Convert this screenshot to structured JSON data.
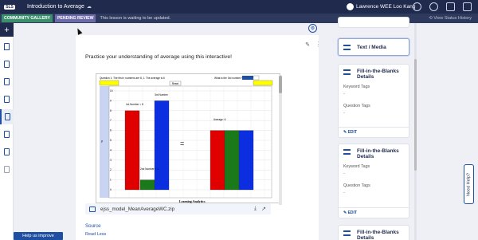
{
  "app": {
    "logo_text": "SLS",
    "lesson_title": "Introduction to Average",
    "user_name": "Lawrence WEE Loo Kang"
  },
  "subbar": {
    "community_badge": "COMMUNITY GALLERY",
    "pending_badge": "PENDING REVIEW",
    "message": "This lesson is waiting to be updated.",
    "history": "View Status History"
  },
  "main": {
    "prompt": "Practice your understanding of average using this interactive!",
    "file_name": "ejss_model_MeanAverageWC.zip",
    "source_label": "Source",
    "read_less": "Read Less",
    "help_button": "Help us improve"
  },
  "sim": {
    "question": "Question 1: The first n numbers are 8, 1. The average is 6",
    "question2": "What is the 3rd number?",
    "reset": "Reset",
    "first_label": "1st Number = 8",
    "second_label": "2nd Number = 1",
    "third_label": "3rd Number",
    "average_label": "Average: 6",
    "footer": "Learning Analytics",
    "equals": "=",
    "y_axis": "y",
    "y_ticks": [
      "10",
      "9",
      "8",
      "7",
      "6",
      "5",
      "4",
      "3",
      "2",
      "1",
      "0"
    ]
  },
  "chart_data": {
    "type": "bar",
    "title": "",
    "categories": [
      "1st Number",
      "2nd Number",
      "3rd Number",
      "Average",
      "Average",
      "Average"
    ],
    "values": [
      8,
      1,
      9,
      6,
      6,
      6
    ],
    "colors": [
      "#e00000",
      "#1a7a1a",
      "#0a2ee0",
      "#e00000",
      "#1a7a1a",
      "#0a2ee0"
    ],
    "ylim": [
      0,
      10
    ],
    "xlabel": "Learning Analytics",
    "ylabel": "y"
  },
  "right_panel": {
    "cards": [
      {
        "title": "Text / Media"
      },
      {
        "title": "Fill-in-the-Blanks Details",
        "label1": "Keyword Tags",
        "value1": "-",
        "label2": "Question Tags",
        "value2": "-",
        "edit": "EDIT"
      },
      {
        "title": "Fill-in-the-Blanks Details",
        "label1": "Keyword Tags",
        "value1": "-",
        "label2": "Question Tags",
        "value2": "-",
        "edit": "EDIT"
      },
      {
        "title": "Fill-in-the-Blanks Details"
      }
    ],
    "need_help": "Need Help?"
  },
  "colors": {
    "topbar": "#1f2a4d",
    "accent": "#1f4fa0",
    "community": "#3b8f6d",
    "pending": "#6d6aa8"
  }
}
